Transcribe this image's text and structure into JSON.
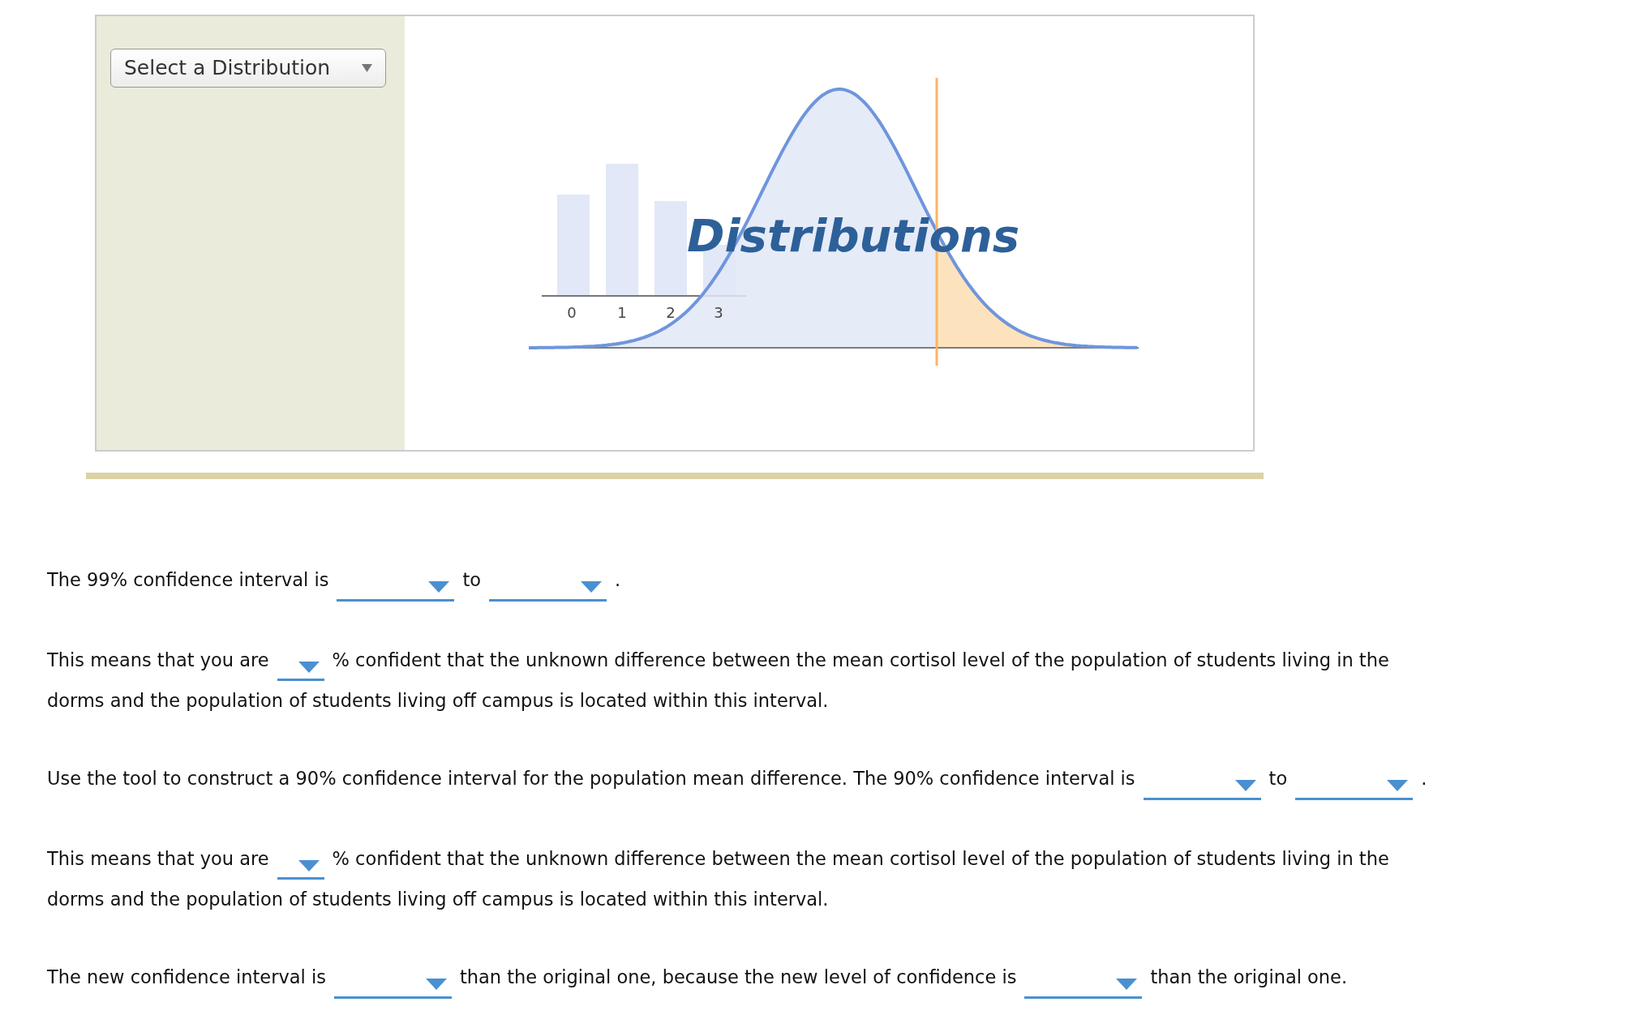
{
  "tool": {
    "menu": {
      "label": "Select a Distribution"
    },
    "graphic": {
      "title": "Distributions",
      "axis_labels": [
        "0",
        "1",
        "2",
        "3"
      ]
    }
  },
  "questions": [
    {
      "lines": [
        [
          {
            "kind": "text",
            "text": "The 99% confidence interval is"
          },
          {
            "kind": "dropdown"
          },
          {
            "kind": "text",
            "text": "to"
          },
          {
            "kind": "dropdown"
          },
          {
            "kind": "text",
            "text": "."
          }
        ]
      ]
    },
    {
      "lines": [
        [
          {
            "kind": "text",
            "text": "This means that you are"
          },
          {
            "kind": "small-dropdown"
          },
          {
            "kind": "text",
            "text": "% confident that the unknown difference between the mean cortisol level of the population of students living in the"
          }
        ],
        [
          {
            "kind": "text",
            "text": "dorms and the population of students living off campus is located within this interval."
          }
        ]
      ]
    },
    {
      "lines": [
        [
          {
            "kind": "text",
            "text": "Use the tool to construct a 90% confidence interval for the population mean difference. The 90% confidence interval is"
          },
          {
            "kind": "dropdown"
          },
          {
            "kind": "text",
            "text": "to"
          },
          {
            "kind": "dropdown"
          },
          {
            "kind": "text",
            "text": "."
          }
        ]
      ]
    },
    {
      "lines": [
        [
          {
            "kind": "text",
            "text": "This means that you are"
          },
          {
            "kind": "small-dropdown"
          },
          {
            "kind": "text",
            "text": "% confident that the unknown difference between the mean cortisol level of the population of students living in the"
          }
        ],
        [
          {
            "kind": "text",
            "text": "dorms and the population of students living off campus is located within this interval."
          }
        ]
      ]
    },
    {
      "lines": [
        [
          {
            "kind": "text",
            "text": "The new confidence interval is"
          },
          {
            "kind": "dropdown"
          },
          {
            "kind": "text",
            "text": "than the original one, because the new level of confidence is"
          },
          {
            "kind": "dropdown"
          },
          {
            "kind": "text",
            "text": "than the original one."
          }
        ]
      ]
    }
  ]
}
